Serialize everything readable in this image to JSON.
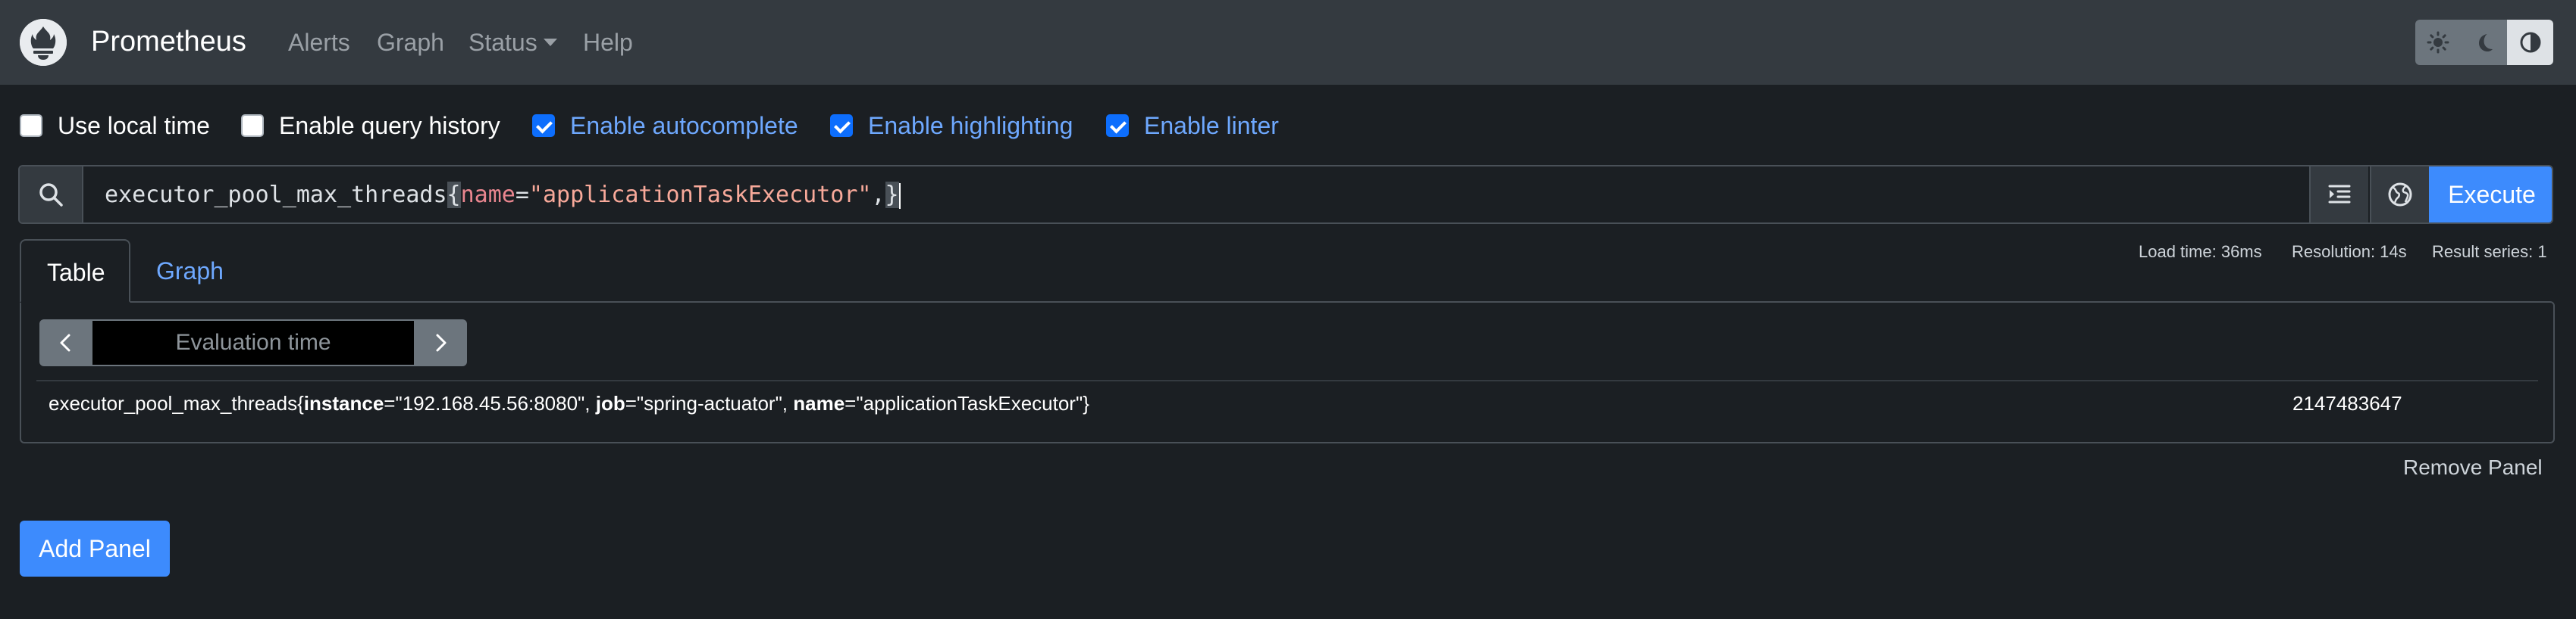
{
  "navbar": {
    "brand": "Prometheus",
    "links": [
      "Alerts",
      "Graph",
      "Status",
      "Help"
    ],
    "theme_buttons": [
      "light-theme",
      "dark-theme",
      "auto-theme"
    ]
  },
  "options": [
    {
      "label": "Use local time",
      "checked": false
    },
    {
      "label": "Enable query history",
      "checked": false
    },
    {
      "label": "Enable autocomplete",
      "checked": true
    },
    {
      "label": "Enable highlighting",
      "checked": true
    },
    {
      "label": "Enable linter",
      "checked": true
    }
  ],
  "query": {
    "metric": "executor_pool_max_threads",
    "open_brace": "{",
    "label_name": "name",
    "operator": "=",
    "label_value": "\"applicationTaskExecutor\"",
    "comma": ",",
    "close_brace": "}",
    "execute_label": "Execute"
  },
  "stats": {
    "load_time": "Load time: 36ms",
    "resolution": "Resolution: 14s",
    "result_series": "Result series: 1"
  },
  "tabs": [
    "Table",
    "Graph"
  ],
  "table_panel": {
    "eval_placeholder": "Evaluation time",
    "result": {
      "metric": "executor_pool_max_threads",
      "open": "{",
      "l1_name": "instance",
      "l1_value": "=\"192.168.45.56:8080\", ",
      "l2_name": "job",
      "l2_value": "=\"spring-actuator\", ",
      "l3_name": "name",
      "l3_value": "=\"applicationTaskExecutor\"",
      "close": "}",
      "value": "2147483647"
    }
  },
  "remove_panel": "Remove Panel",
  "add_panel": "Add Panel",
  "colors": {
    "accent": "#3d8bfd",
    "navbar": "#343a40",
    "background": "#1b1f23"
  }
}
